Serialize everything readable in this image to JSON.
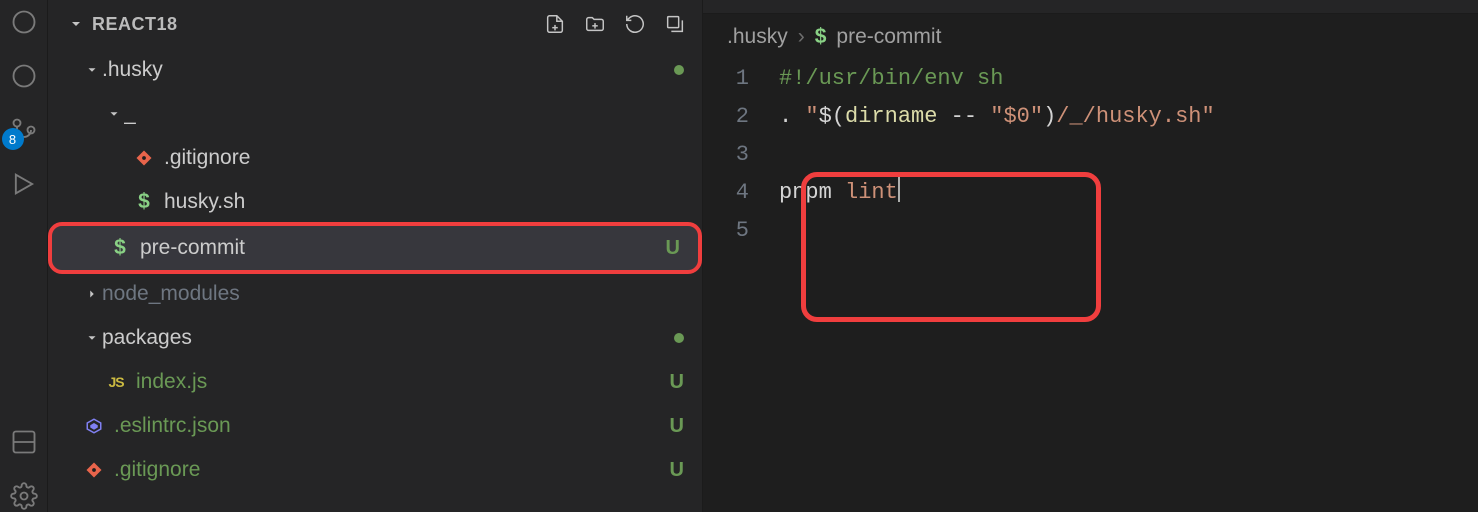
{
  "activity": {
    "badge_count": "8"
  },
  "sidebar": {
    "root_label": "REACT18",
    "items": [
      {
        "label": ".husky",
        "status_dot": true
      },
      {
        "label": "_"
      },
      {
        "label": ".gitignore"
      },
      {
        "label": "husky.sh"
      },
      {
        "label": "pre-commit",
        "status": "U"
      },
      {
        "label": "node_modules"
      },
      {
        "label": "packages",
        "status_dot": true
      },
      {
        "label": "index.js",
        "status": "U"
      },
      {
        "label": ".eslintrc.json",
        "status": "U"
      },
      {
        "label": ".gitignore",
        "status": "U"
      }
    ]
  },
  "breadcrumb": {
    "folder": ".husky",
    "file": "pre-commit"
  },
  "code": {
    "lines": [
      "1",
      "2",
      "3",
      "4",
      "5"
    ],
    "l1_comment": "#!/usr/bin/env sh",
    "l2_dot": ". ",
    "l2_q1": "\"",
    "l2_dollar_open": "$(",
    "l2_dirname": "dirname",
    "l2_dash": " -- ",
    "l2_q2": "\"",
    "l2_arg": "$0",
    "l2_q3": "\"",
    "l2_close": ")",
    "l2_tail": "/_/husky.sh",
    "l2_q4": "\"",
    "l4_cmd": "pnpm ",
    "l4_arg": "lint"
  }
}
